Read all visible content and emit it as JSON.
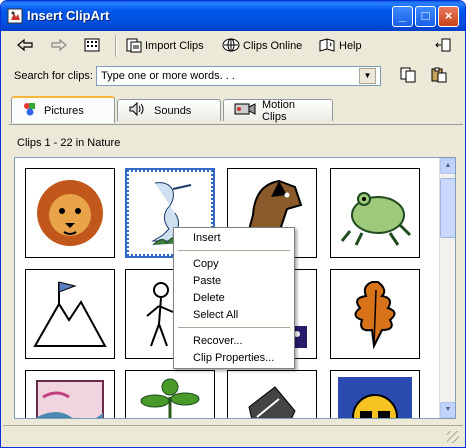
{
  "window": {
    "title": "Insert ClipArt"
  },
  "titlebar_buttons": {
    "minimize": "_",
    "maximize": "□",
    "close": "×"
  },
  "toolbar": {
    "back_label": "",
    "forward_label": "",
    "import_label": "Import Clips",
    "online_label": "Clips Online",
    "help_label": "Help"
  },
  "search": {
    "label": "Search for clips:",
    "value": "Type one or more words. . ."
  },
  "tabs": [
    {
      "label": "Pictures",
      "icon": "pictures-icon",
      "active": true
    },
    {
      "label": "Sounds",
      "icon": "sounds-icon",
      "active": false
    },
    {
      "label": "Motion Clips",
      "icon": "motion-clips-icon",
      "active": false
    }
  ],
  "clips": {
    "header": "Clips 1 - 22 in Nature",
    "items": [
      {
        "icon": "lion-clipart"
      },
      {
        "icon": "heron-clipart"
      },
      {
        "icon": "horse-clipart"
      },
      {
        "icon": "frog-clipart"
      },
      {
        "icon": "mountain-flag-clipart"
      },
      {
        "icon": "hiker-clipart"
      },
      {
        "icon": "purple-clipart"
      },
      {
        "icon": "oak-leaves-clipart"
      },
      {
        "icon": "landscape-clipart"
      },
      {
        "icon": "plant-clipart"
      },
      {
        "icon": "rocks-clipart"
      },
      {
        "icon": "sun-clipart"
      }
    ]
  },
  "context_menu": {
    "insert": "Insert",
    "copy": "Copy",
    "paste": "Paste",
    "delete": "Delete",
    "select_all": "Select All",
    "recover": "Recover...",
    "clip_properties": "Clip Properties..."
  },
  "colors": {
    "titlebar": "#0058ee",
    "window_bg": "#ece9d8",
    "selection": "#316ac5"
  }
}
